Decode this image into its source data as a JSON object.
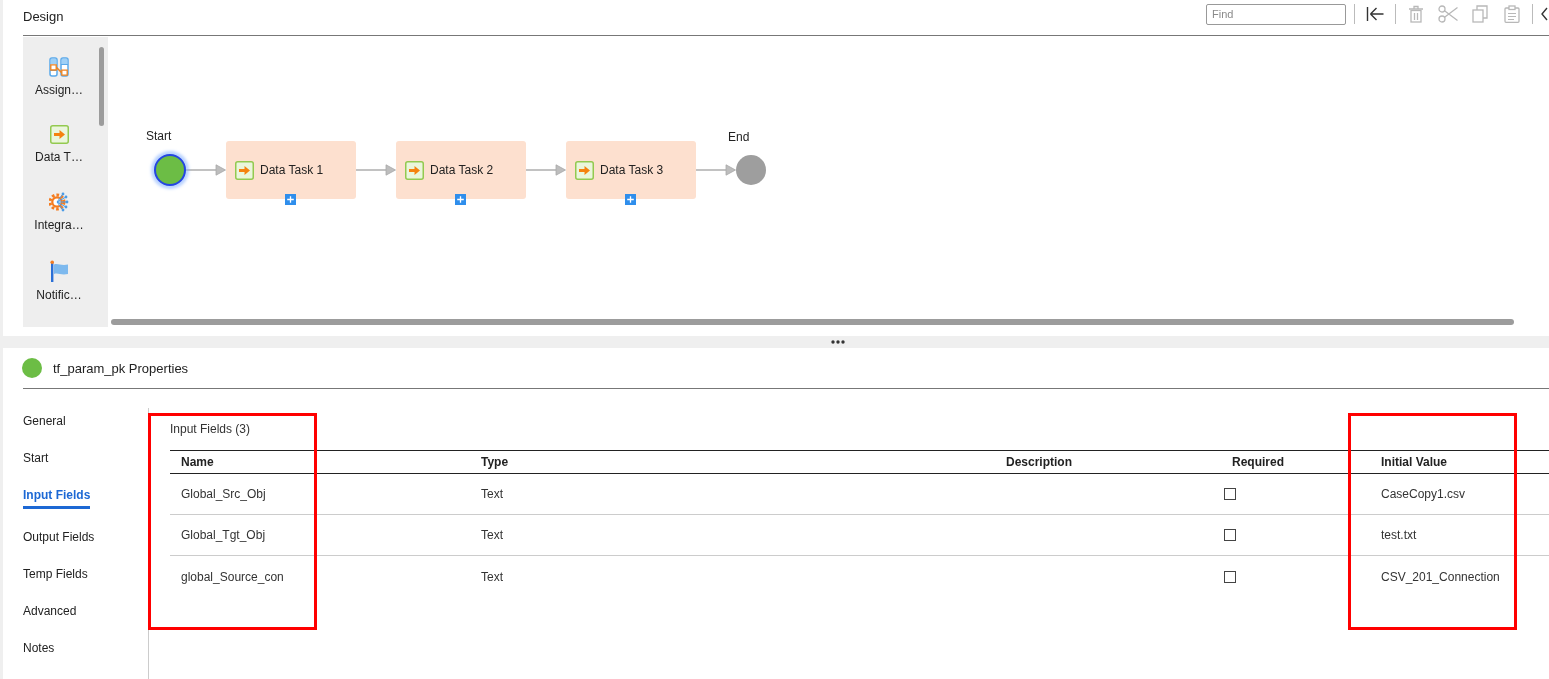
{
  "design": {
    "title": "Design",
    "toolbar": {
      "search": {
        "placeholder": "Find"
      },
      "groups": [
        [
          {
            "kind": "go-to-start",
            "disabled": false
          }
        ],
        [
          {
            "kind": "delete",
            "disabled": true
          },
          {
            "kind": "cut",
            "disabled": true
          },
          {
            "kind": "copy",
            "disabled": true
          },
          {
            "kind": "paste",
            "disabled": true
          }
        ],
        [
          {
            "kind": "collapse",
            "disabled": false
          }
        ]
      ]
    },
    "palette": {
      "items": [
        {
          "kind": "assignment",
          "label": "Assign…"
        },
        {
          "kind": "data-task",
          "label": "Data T…"
        },
        {
          "kind": "integration",
          "label": "Integra…"
        },
        {
          "kind": "notification",
          "label": "Notific…"
        }
      ]
    },
    "diagram": {
      "nodes": [
        {
          "kind": "start",
          "label": "Start",
          "selected": true
        },
        {
          "kind": "task",
          "label": "Data Task 1",
          "selected": false
        },
        {
          "kind": "task",
          "label": "Data Task 2",
          "selected": false
        },
        {
          "kind": "task",
          "label": "Data Task 3",
          "selected": false
        },
        {
          "kind": "end",
          "label": "End",
          "selected": false
        }
      ]
    }
  },
  "properties": {
    "title": "tf_param_pk Properties",
    "nav": [
      {
        "label": "General",
        "selected": false
      },
      {
        "label": "Start",
        "selected": false
      },
      {
        "label": "Input Fields",
        "selected": true
      },
      {
        "label": "Output Fields",
        "selected": false
      },
      {
        "label": "Temp Fields",
        "selected": false
      },
      {
        "label": "Advanced",
        "selected": false
      },
      {
        "label": "Notes",
        "selected": false
      }
    ],
    "input_fields": {
      "title": "Input Fields (3)",
      "columns": [
        {
          "label": "Name",
          "highlighted": true
        },
        {
          "label": "Type",
          "highlighted": false
        },
        {
          "label": "Description",
          "highlighted": false
        },
        {
          "label": "Required",
          "highlighted": false
        },
        {
          "label": "Initial Value",
          "highlighted": true
        }
      ],
      "rows": [
        {
          "name": "Global_Src_Obj",
          "type": "Text",
          "required": false,
          "initial_value": "CaseCopy1.csv"
        },
        {
          "name": "Global_Tgt_Obj",
          "type": "Text",
          "required": false,
          "initial_value": "test.txt"
        },
        {
          "name": "global_Source_con",
          "type": "Text",
          "required": false,
          "initial_value": "CSV_201_Connection"
        }
      ]
    }
  }
}
